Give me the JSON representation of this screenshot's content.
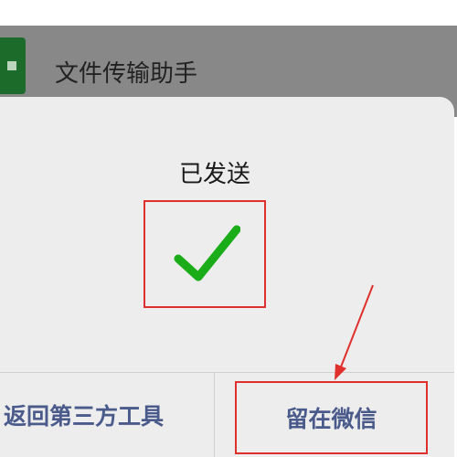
{
  "chat_header": {
    "title": "文件传输助手",
    "icon": "file-transfer-app-icon"
  },
  "dialog": {
    "title": "已发送",
    "status_icon": "checkmark-icon",
    "buttons": {
      "back_label": "返回第三方工具",
      "stay_label": "留在微信"
    }
  },
  "colors": {
    "check_green": "#1aad19",
    "highlight_red": "#e0302d",
    "button_text": "#4a5a8a",
    "dialog_bg": "#ededed",
    "overlay": "#888888"
  }
}
